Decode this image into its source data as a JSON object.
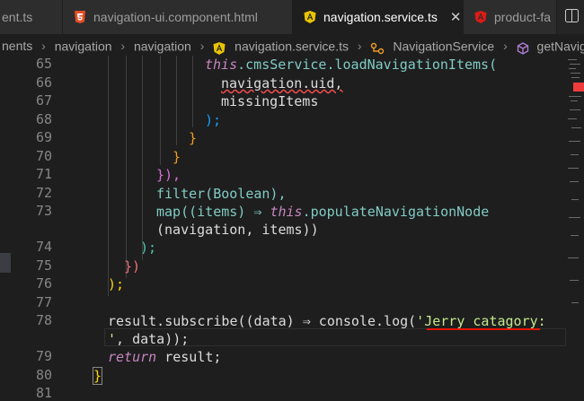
{
  "tabs": [
    {
      "label": "ent.ts",
      "icon": "typescript-icon",
      "active": false
    },
    {
      "label": "navigation-ui.component.html",
      "icon": "html5-icon",
      "active": false
    },
    {
      "label": "navigation.service.ts",
      "icon": "angular-icon",
      "active": true
    },
    {
      "label": "product-fa",
      "icon": "angular-icon",
      "active": false
    }
  ],
  "close_glyph": "✕",
  "breadcrumbs": [
    "nents",
    "navigation",
    "navigation",
    "navigation.service.ts",
    "NavigationService",
    "getNavigation"
  ],
  "line_numbers": [
    "65",
    "66",
    "67",
    "68",
    "69",
    "70",
    "71",
    "72",
    "73",
    "",
    "74",
    "75",
    "76",
    "77",
    "78",
    "",
    "79",
    "80",
    "81"
  ],
  "code": {
    "l65_this": "this",
    "l65_rest": ".cmsService.loadNavigationItems(",
    "l66": "navigation.uid,",
    "l67": "missingItems",
    "l68": ");",
    "l69": "}",
    "l70": "}",
    "l71": "}),",
    "l72": "filter(Boolean),",
    "l73a": "map((items) ⇒ ",
    "l73a_this": "this",
    "l73a_rest": ".populateNavigationNode",
    "l73b": "(navigation, items))",
    "l74": ");",
    "l75": "})",
    "l76": ");",
    "l78a_pre": "result.subscribe((data) ⇒ console.log(",
    "l78a_str": "'Jerry catagory:",
    "l78b_str": "'",
    "l78b_rest": ", data));",
    "l79_kw": "return",
    "l79_rest": " result;",
    "l80": "}"
  },
  "colors": {
    "accent_underline": "#e51400",
    "bg": "#1e1e1e"
  }
}
